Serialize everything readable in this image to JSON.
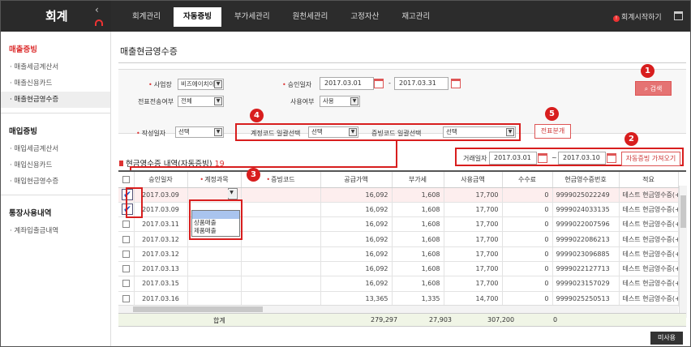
{
  "app": {
    "logo": "회계",
    "collapse_icon": "‹",
    "start_label": "회계시작하기",
    "start_dot": "!",
    "nav": [
      "회계관리",
      "자동증빙",
      "부가세관리",
      "원천세관리",
      "고정자산",
      "재고관리"
    ]
  },
  "sidebar": {
    "sections": [
      {
        "title": "매출증빙",
        "items": [
          "매출세금계산서",
          "매출신용카드",
          "매출현금영수증"
        ]
      },
      {
        "title": "매입증빙",
        "items": [
          "매입세금계산서",
          "매입신용카드",
          "매입현금영수증"
        ]
      },
      {
        "title": "통장사용내역",
        "items": [
          "계좌입출금내역"
        ]
      }
    ]
  },
  "page": {
    "title": "매출현금영수증"
  },
  "filter": {
    "business_label": "사업장",
    "business_value": "비즈에이치이",
    "transfer_label": "전표전송여부",
    "transfer_value": "전체",
    "approval_label": "승인일자",
    "date_from": "2017.03.01",
    "date_sep": "-",
    "date_to": "2017.03.31",
    "usage_label": "사용여부",
    "usage_value": "사용",
    "search_label": "검색",
    "author_label": "작성일자",
    "author_value": "선택",
    "account_bulk_label": "계정코드 일괄선택",
    "account_bulk_value": "선택",
    "proof_bulk_label": "증빙코드 일괄선택",
    "proof_bulk_value": "선택",
    "split_label": "전표분개"
  },
  "list": {
    "title": "현금영수증 내역(자동증빙)",
    "count": "19",
    "trade_date_label": "거래일자",
    "trade_from": "2017.03.01",
    "trade_sep": "~",
    "trade_to": "2017.03.10",
    "fetch_label": "자동증빙 가져오기"
  },
  "table": {
    "headers": [
      "승인일자",
      "계정과목",
      "증빙코드",
      "공급가액",
      "부가세",
      "사용금액",
      "수수료",
      "현금영수증번호",
      "적요"
    ],
    "rows": [
      {
        "date": "2017.03.09",
        "supply": "16,092",
        "vat": "1,608",
        "amount": "17,700",
        "fee": "0",
        "receipt": "9999025022249",
        "memo": "테스트 현금영수증(+"
      },
      {
        "date": "2017.03.09",
        "supply": "16,092",
        "vat": "1,608",
        "amount": "17,700",
        "fee": "0",
        "receipt": "9999024033135",
        "memo": "테스트 현금영수증(+"
      },
      {
        "date": "2017.03.11",
        "supply": "16,092",
        "vat": "1,608",
        "amount": "17,700",
        "fee": "0",
        "receipt": "9999022007596",
        "memo": "테스트 현금영수증(+"
      },
      {
        "date": "2017.03.12",
        "supply": "16,092",
        "vat": "1,608",
        "amount": "17,700",
        "fee": "0",
        "receipt": "9999022086213",
        "memo": "테스트 현금영수증(+"
      },
      {
        "date": "2017.03.12",
        "supply": "16,092",
        "vat": "1,608",
        "amount": "17,700",
        "fee": "0",
        "receipt": "9999023096885",
        "memo": "테스트 현금영수증(+"
      },
      {
        "date": "2017.03.13",
        "supply": "16,092",
        "vat": "1,608",
        "amount": "17,700",
        "fee": "0",
        "receipt": "9999022127713",
        "memo": "테스트 현금영수증(+"
      },
      {
        "date": "2017.03.15",
        "supply": "16,092",
        "vat": "1,608",
        "amount": "17,700",
        "fee": "0",
        "receipt": "9999023157029",
        "memo": "테스트 현금영수증(+"
      },
      {
        "date": "2017.03.16",
        "supply": "13,365",
        "vat": "1,335",
        "amount": "14,700",
        "fee": "0",
        "receipt": "9999025250513",
        "memo": "테스트 현금영수증(+"
      }
    ],
    "dropdown_options": [
      "",
      "상품매출",
      "제품매출"
    ],
    "total_label": "합계",
    "total_supply": "279,297",
    "total_vat": "27,903",
    "total_amount": "307,200",
    "total_fee": "0"
  },
  "unused_label": "미사용",
  "badges": [
    "1",
    "2",
    "3",
    "4",
    "5"
  ],
  "accent_color": "#d81e1e"
}
